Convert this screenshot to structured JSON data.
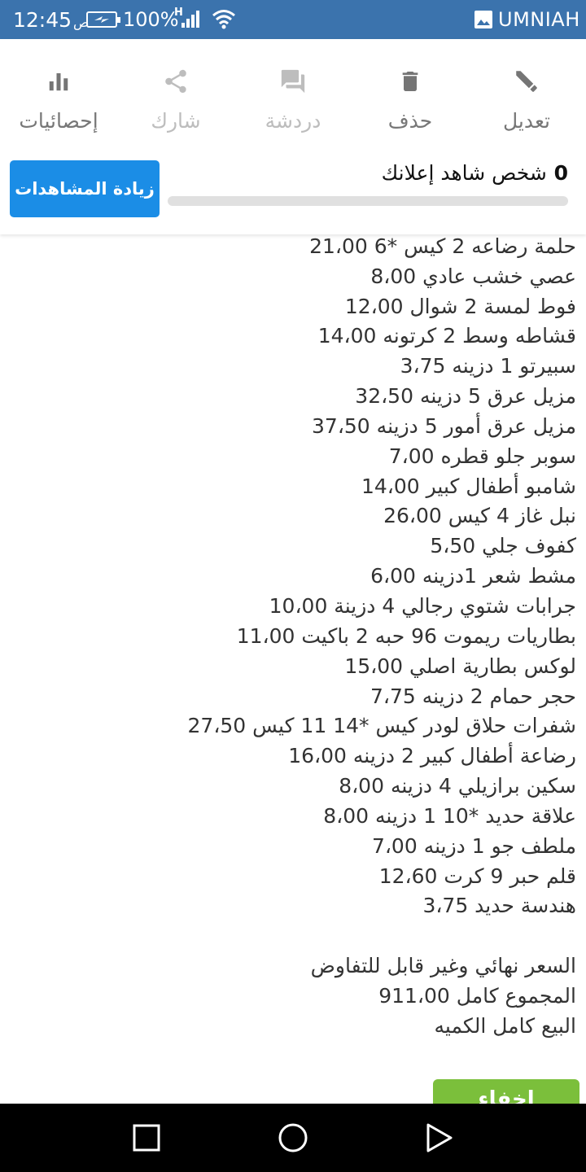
{
  "status_bar": {
    "time": "12:45",
    "ampm": "ص",
    "battery_percent": "100%",
    "network_type": "H",
    "carrier": "UMNIAH"
  },
  "toolbar": {
    "actions": [
      {
        "label": "تعديل",
        "icon": "pencil-icon",
        "enabled": true
      },
      {
        "label": "حذف",
        "icon": "trash-icon",
        "enabled": true
      },
      {
        "label": "دردشة",
        "icon": "chat-icon",
        "enabled": false
      },
      {
        "label": "شارك",
        "icon": "share-icon",
        "enabled": false
      },
      {
        "label": "إحصائيات",
        "icon": "bar-chart-icon",
        "enabled": true
      }
    ]
  },
  "views": {
    "count": "0",
    "text": "شخص شاهد إعلانك",
    "progress": 0,
    "boost_label": "زيادة المشاهدات"
  },
  "listing": {
    "lines": [
      "مزيل عرق 5 دزينه 32،50",
      "مزيل عرق أمور 5 دزينه 37،50",
      "سوبر جلو قطره 7،00",
      "شامبو أطفال كبير 14،00",
      "نبل غاز 4 كيس 26،00",
      "كفوف جلي 5،50",
      "مشط شعر 1دزينه 6،00",
      "جرابات شتوي رجالي 4 دزينة 10،00",
      "بطاريات ريموت 96 حبه 2 باكيت 11،00",
      "لوكس بطارية اصلي 15،00",
      "حجر حمام 2 دزينه 7،75",
      "شفرات حلاق لودر كيس *14  11 كيس 27،50",
      "رضاعة أطفال كبير 2 دزينه 16،00",
      "سكين برازيلي 4 دزينه 8،00",
      "علاقة حديد *10 1 دزينه 8،00",
      "ملطف جو 1 دزينه 7،00",
      "قلم حبر 9 كرت 12،60",
      "هندسة حديد 3،75",
      "",
      "السعر نهائي وغير قابل للتفاوض",
      "المجموع كامل 911،00",
      "البيع كامل الكميه"
    ],
    "hide_details_label": "اخفاء التفاصيل",
    "upper_lines": [
      "حلمة رضاعه 2 كيس *6 21،00",
      "عصي خشب عادي 8،00",
      "فوط لمسة 2 شوال 12،00",
      "قشاطه وسط 2 كرتونه 14،00",
      "سبيرتو 1 دزينه 3،75"
    ]
  },
  "colors": {
    "status_bar": "#3b73ad",
    "boost_button": "#1b8de6",
    "hide_button": "#7bbf3b",
    "text": "#333333"
  }
}
